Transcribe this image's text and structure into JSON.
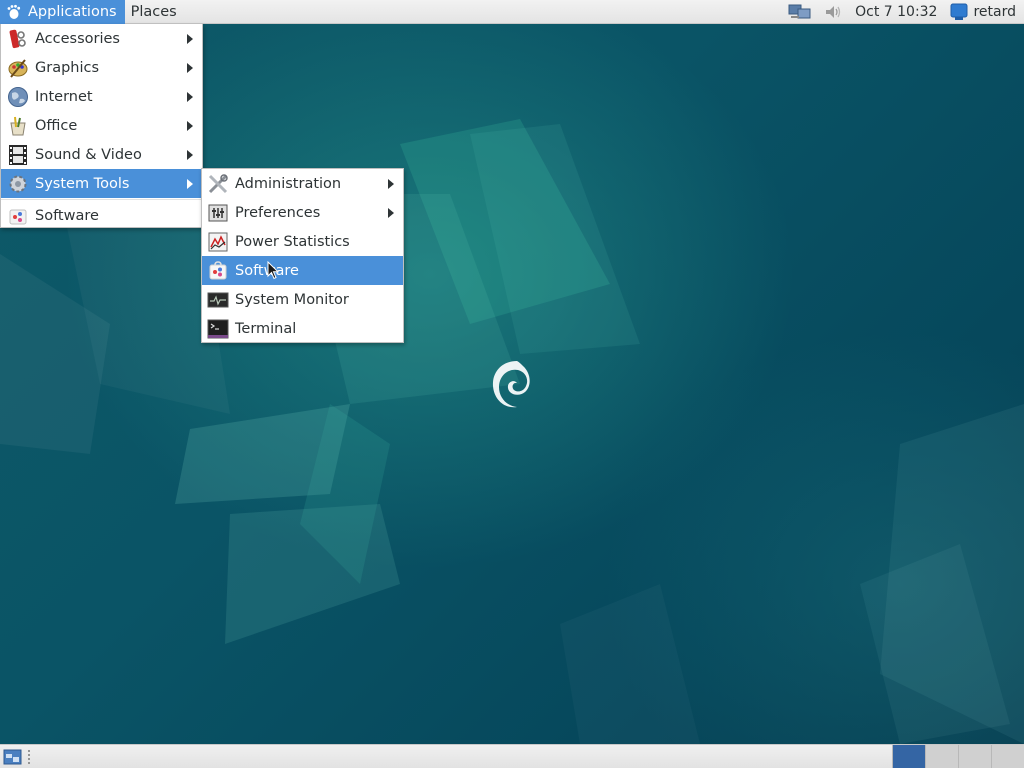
{
  "top_panel": {
    "applications_label": "Applications",
    "places_label": "Places",
    "clock": "Oct 7  10:32",
    "user_name": "retard",
    "icons": [
      "debian-foot-icon",
      "network-icon",
      "volume-icon",
      "user-icon"
    ]
  },
  "applications_menu": {
    "items": [
      {
        "label": "Accessories",
        "icon": "accessories-icon",
        "submenu": true
      },
      {
        "label": "Graphics",
        "icon": "graphics-icon",
        "submenu": true
      },
      {
        "label": "Internet",
        "icon": "internet-icon",
        "submenu": true
      },
      {
        "label": "Office",
        "icon": "office-icon",
        "submenu": true
      },
      {
        "label": "Sound & Video",
        "icon": "sound-video-icon",
        "submenu": true
      },
      {
        "label": "System Tools",
        "icon": "system-tools-icon",
        "submenu": true,
        "highlighted": true
      },
      {
        "label": "Software",
        "icon": "software-icon",
        "submenu": false
      }
    ]
  },
  "system_tools_menu": {
    "items": [
      {
        "label": "Administration",
        "icon": "administration-icon",
        "submenu": true
      },
      {
        "label": "Preferences",
        "icon": "preferences-icon",
        "submenu": true
      },
      {
        "label": "Power Statistics",
        "icon": "power-statistics-icon",
        "submenu": false
      },
      {
        "label": "Software",
        "icon": "software-icon",
        "submenu": false,
        "highlighted": true
      },
      {
        "label": "System Monitor",
        "icon": "system-monitor-icon",
        "submenu": false
      },
      {
        "label": "Terminal",
        "icon": "terminal-icon",
        "submenu": false
      }
    ]
  },
  "bottom_panel": {
    "workspaces": 4,
    "active_workspace": 1
  },
  "colors": {
    "highlight": "#4a90d9",
    "desktop": "#0b4f5f",
    "active_workspace": "#3465a4"
  }
}
